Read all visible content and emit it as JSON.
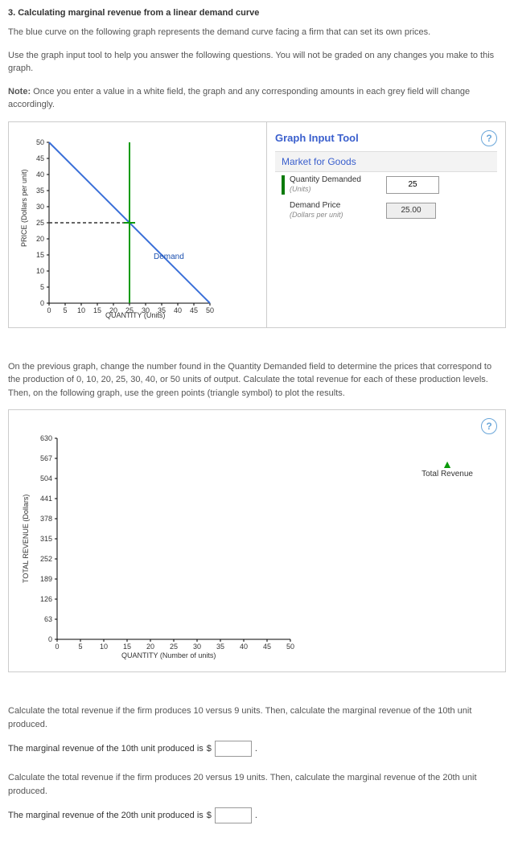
{
  "title": "3. Calculating marginal revenue from a linear demand curve",
  "intro1": "The blue curve on the following graph represents the demand curve facing a firm that can set its own prices.",
  "intro2": "Use the graph input tool to help you answer the following questions. You will not be graded on any changes you make to this graph.",
  "note_label": "Note:",
  "note_text": " Once you enter a value in a white field, the graph and any corresponding amounts in each grey field will change accordingly.",
  "graph_tool": {
    "title": "Graph Input Tool",
    "section": "Market for Goods",
    "qty_label": "Quantity Demanded",
    "qty_sub": "(Units)",
    "qty_value": "25",
    "price_label": "Demand Price",
    "price_sub": "(Dollars per unit)",
    "price_value": "25.00"
  },
  "chart_data": [
    {
      "type": "line",
      "title": "",
      "xlabel": "QUANTITY (Units)",
      "ylabel": "PRICE (Dollars per unit)",
      "x_ticks": [
        0,
        5,
        10,
        15,
        20,
        25,
        30,
        35,
        40,
        45,
        50
      ],
      "y_ticks": [
        0,
        5,
        10,
        15,
        20,
        25,
        30,
        35,
        40,
        45,
        50
      ],
      "xlim": [
        0,
        50
      ],
      "ylim": [
        0,
        50
      ],
      "series": [
        {
          "name": "Demand",
          "x": [
            0,
            50
          ],
          "y": [
            50,
            0
          ],
          "color": "#3a6fd8"
        }
      ],
      "tracker": {
        "x": 25,
        "y": 25
      },
      "dashed_from": {
        "x": 0,
        "y": 25
      },
      "annotation": "Demand"
    },
    {
      "type": "scatter",
      "title": "",
      "xlabel": "QUANTITY (Number of units)",
      "ylabel": "TOTAL REVENUE (Dollars)",
      "x_ticks": [
        0,
        5,
        10,
        15,
        20,
        25,
        30,
        35,
        40,
        45,
        50
      ],
      "y_ticks": [
        0,
        63,
        126,
        189,
        252,
        315,
        378,
        441,
        504,
        567,
        630
      ],
      "xlim": [
        0,
        50
      ],
      "ylim": [
        0,
        630
      ],
      "legend": "Total Revenue",
      "plotted_points": []
    }
  ],
  "mid_text": "On the previous graph, change the number found in the Quantity Demanded field to determine the prices that correspond to the production of 0, 10, 20, 25, 30, 40, or 50 units of output. Calculate the total revenue for each of these production levels. Then, on the following graph, use the green points (triangle symbol) to plot the results.",
  "q1_prompt": "Calculate the total revenue if the firm produces 10 versus 9 units. Then, calculate the marginal revenue of the 10th unit produced.",
  "q1_line_a": "The marginal revenue of the 10th unit produced is ",
  "q1_prefix": "$",
  "q1_suffix": ".",
  "q2_prompt": "Calculate the total revenue if the firm produces 20 versus 19 units. Then, calculate the marginal revenue of the 20th unit produced.",
  "q2_line_a": "The marginal revenue of the 20th unit produced is ",
  "q2_prefix": "$",
  "q2_suffix": "."
}
